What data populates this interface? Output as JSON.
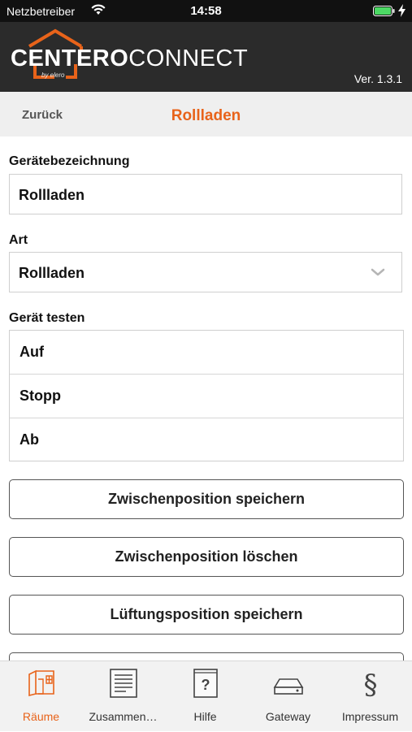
{
  "status_bar": {
    "carrier": "Netzbetreiber",
    "time": "14:58"
  },
  "header": {
    "logo_bold": "CENTERO",
    "logo_light": "CONNECT",
    "logo_sub": "by elero",
    "version": "Ver. 1.3.1"
  },
  "nav": {
    "back_label": "Zurück",
    "title": "Rollladen"
  },
  "form": {
    "name_label": "Gerätebezeichnung",
    "name_value": "Rollladen",
    "type_label": "Art",
    "type_value": "Rollladen",
    "test_label": "Gerät testen",
    "test_buttons": [
      "Auf",
      "Stopp",
      "Ab"
    ]
  },
  "actions": [
    "Zwischenposition speichern",
    "Zwischenposition löschen",
    "Lüftungsposition speichern"
  ],
  "tabs": [
    {
      "label": "Räume",
      "icon": "rooms-icon",
      "active": true
    },
    {
      "label": "Zusammen…",
      "icon": "document-icon",
      "active": false
    },
    {
      "label": "Hilfe",
      "icon": "help-icon",
      "active": false
    },
    {
      "label": "Gateway",
      "icon": "gateway-icon",
      "active": false
    },
    {
      "label": "Impressum",
      "icon": "paragraph-icon",
      "active": false
    }
  ],
  "colors": {
    "accent": "#e8631a",
    "header_bg": "#2b2b2b",
    "status_bg": "#111111",
    "battery": "#4cd964"
  }
}
